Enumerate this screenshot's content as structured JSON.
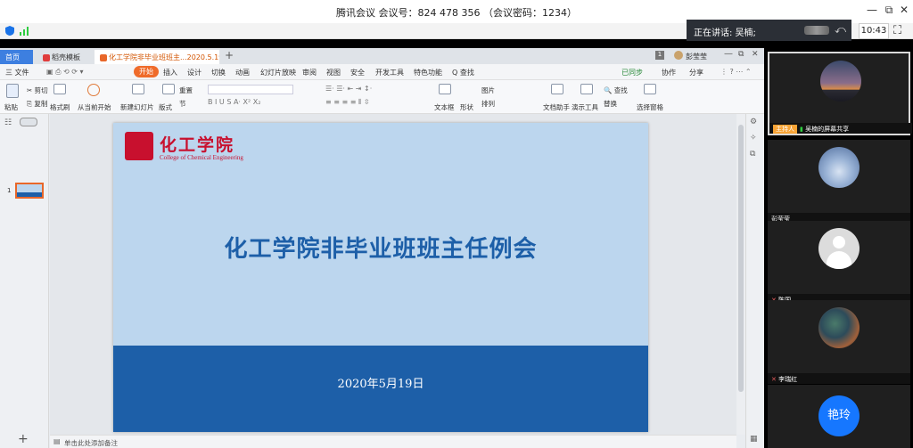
{
  "window": {
    "title": "腾讯会议 会议号：824 478 356 （会议密码：1234）",
    "minimize_glyph": "—",
    "restore_glyph": "⧉",
    "close_glyph": "✕"
  },
  "speaking": {
    "label": "正在讲话: 吴楠;"
  },
  "clock": "10:43",
  "wps": {
    "tabs": [
      {
        "label": "首页"
      },
      {
        "label": "稻壳模板"
      },
      {
        "label": "化工学院非毕业班班主...2020.5.19)"
      }
    ],
    "user_name": "彭莹莹",
    "menus": [
      "三 文件",
      "开始",
      "插入",
      "设计",
      "切换",
      "动画",
      "幻灯片放映",
      "审阅",
      "视图",
      "安全",
      "开发工具",
      "特色功能",
      "Q 查找"
    ],
    "menu_right": [
      "已同步",
      "协作",
      "分享"
    ],
    "ribbon": {
      "paste": "粘贴",
      "cut": "剪切",
      "copy": "复制",
      "format_painter": "格式刷",
      "from_current": "从当前开始",
      "new_slide": "新建幻灯片",
      "layout": "版式",
      "reset": "重置",
      "section": "节",
      "textbox": "文本框",
      "shape": "形状",
      "picture": "图片",
      "arrange": "排列",
      "doc_assistant": "文档助手",
      "presentation_tools": "演示工具",
      "find": "查找",
      "replace": "替换",
      "select_pane": "选择窗格"
    },
    "slide": {
      "logo_cn": "化工学院",
      "logo_en": "College of Chemical Engineering",
      "title": "化工学院非毕业班班主任例会",
      "date": "2020年5月19日"
    },
    "thumb_number": "1",
    "notes_placeholder": "单击此处添加备注",
    "add_glyph": "+"
  },
  "participants": [
    {
      "name": "吴楠的屏幕共享",
      "host_badge": "主持人",
      "avatar_style": "sunset"
    },
    {
      "name": "彭莹莹",
      "avatar_style": "sky"
    },
    {
      "name": "陈国",
      "avatar_style": "default"
    },
    {
      "name": "李瑞红",
      "avatar_style": "forest"
    },
    {
      "name": "艳玲",
      "avatar_style": "initials"
    }
  ],
  "colors": {
    "accent_blue": "#1d5fa8",
    "slide_bg": "#bcd6ee",
    "logo_red": "#c8102e",
    "wps_active_tab": "#ffffff",
    "host_badge": "#f7a335",
    "initials_avatar": "#1677ff"
  }
}
